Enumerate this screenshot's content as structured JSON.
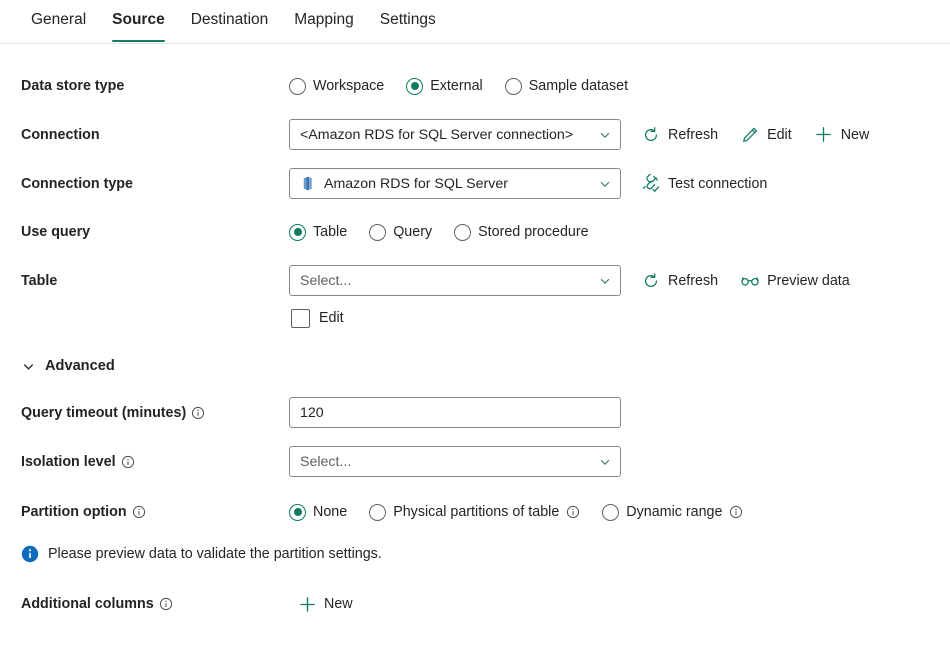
{
  "colors": {
    "accent_teal": "#107c62",
    "radio_selected": "#0f7b61",
    "info_blue": "#0f6cbd",
    "field_border": "#8a8886",
    "text": "#242424",
    "placeholder": "#605e5c",
    "aws_icon_blue": "#4a7fb5"
  },
  "tabs": [
    {
      "label": "General",
      "active": false
    },
    {
      "label": "Source",
      "active": true
    },
    {
      "label": "Destination",
      "active": false
    },
    {
      "label": "Mapping",
      "active": false
    },
    {
      "label": "Settings",
      "active": false
    }
  ],
  "data_store_type": {
    "label": "Data store type",
    "options": [
      {
        "label": "Workspace",
        "selected": false
      },
      {
        "label": "External",
        "selected": true
      },
      {
        "label": "Sample dataset",
        "selected": false
      }
    ]
  },
  "connection": {
    "label": "Connection",
    "value": "<Amazon RDS for SQL Server connection>",
    "chevron_icon": "chevron-down-icon",
    "actions": [
      {
        "label": "Refresh",
        "icon": "refresh-icon"
      },
      {
        "label": "Edit",
        "icon": "pencil-icon"
      },
      {
        "label": "New",
        "icon": "plus-icon"
      }
    ]
  },
  "connection_type": {
    "label": "Connection type",
    "value": "Amazon RDS for SQL Server",
    "lead_icon": "amazon-rds-icon",
    "chevron_icon": "chevron-down-icon",
    "actions": [
      {
        "label": "Test connection",
        "icon": "plug-check-icon"
      }
    ]
  },
  "use_query": {
    "label": "Use query",
    "options": [
      {
        "label": "Table",
        "selected": true
      },
      {
        "label": "Query",
        "selected": false
      },
      {
        "label": "Stored procedure",
        "selected": false
      }
    ]
  },
  "table": {
    "label": "Table",
    "placeholder": "Select...",
    "value": "",
    "chevron_icon": "chevron-down-icon",
    "actions": [
      {
        "label": "Refresh",
        "icon": "refresh-icon"
      },
      {
        "label": "Preview data",
        "icon": "glasses-icon"
      }
    ],
    "edit_checkbox": {
      "label": "Edit",
      "checked": false
    }
  },
  "advanced": {
    "label": "Advanced",
    "expanded": true,
    "chevron_icon": "chevron-down-icon"
  },
  "query_timeout": {
    "label": "Query timeout (minutes)",
    "info_icon": "info-outline-icon",
    "value": "120"
  },
  "isolation_level": {
    "label": "Isolation level",
    "info_icon": "info-outline-icon",
    "placeholder": "Select...",
    "value": "",
    "chevron_icon": "chevron-down-icon"
  },
  "partition_option": {
    "label": "Partition option",
    "info_icon": "info-outline-icon",
    "options": [
      {
        "label": "None",
        "selected": true,
        "info": false
      },
      {
        "label": "Physical partitions of table",
        "selected": false,
        "info": true
      },
      {
        "label": "Dynamic range",
        "selected": false,
        "info": true
      }
    ]
  },
  "message": {
    "icon": "info-filled-icon",
    "text": "Please preview data to validate the partition settings."
  },
  "additional_columns": {
    "label": "Additional columns",
    "info_icon": "info-outline-icon",
    "action": {
      "label": "New",
      "icon": "plus-icon"
    }
  }
}
